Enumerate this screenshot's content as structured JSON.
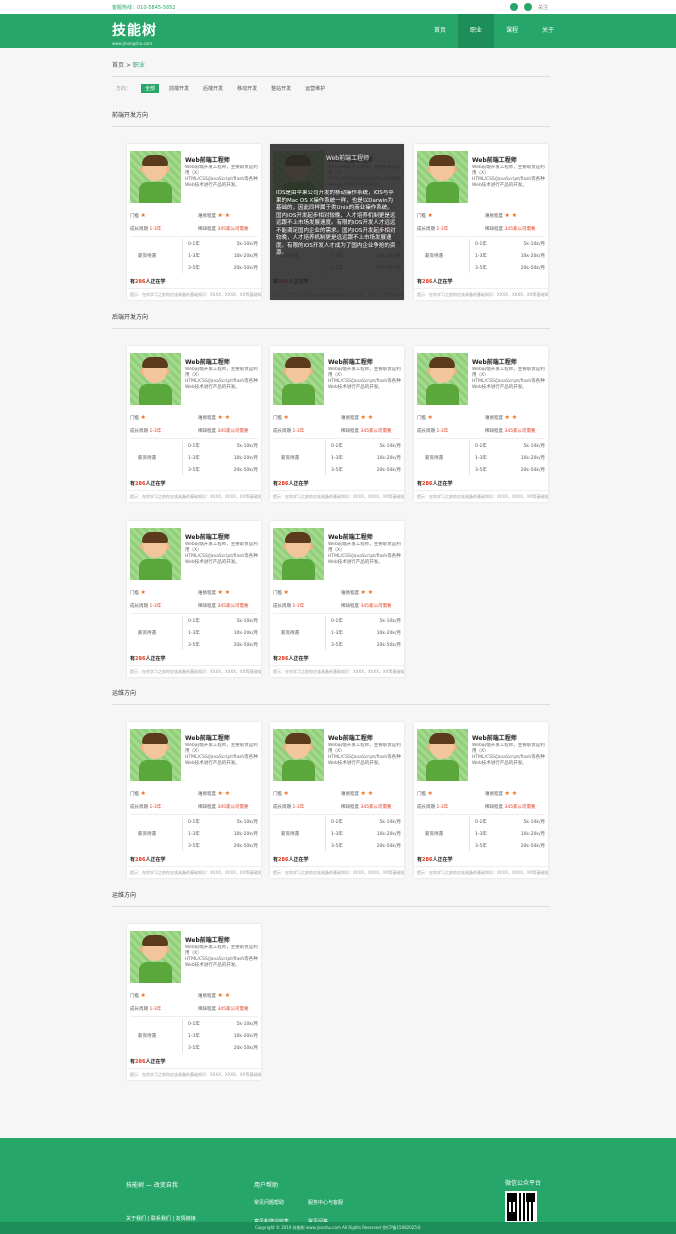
{
  "topbar": {
    "phone": "客服热线：010-5845-5852",
    "icons": [
      "weixin-icon",
      "weibo-icon"
    ],
    "qq": "关注"
  },
  "header": {
    "logo": "技能树",
    "logo_sub": "www.jinengshu.com"
  },
  "nav": [
    "首页",
    "职业",
    "课程",
    "关于"
  ],
  "breadcrumb": {
    "home": "首页",
    "sep": " > ",
    "current": "职业"
  },
  "filters": {
    "label": "方向：",
    "items": [
      "全部",
      "前端开发",
      "后端开发",
      "移动开发",
      "整站开发",
      "运营维护"
    ],
    "active": 0
  },
  "sections": [
    "前端开发方向",
    "后端开发方向",
    "运维方向",
    "运维方向"
  ],
  "card": {
    "title": "Web前端工程师",
    "desc": "Web前端开发工程师，主要职责是利用（X）HTML/CSS/JavaScript/flash等各种Web技术进行产品的开发。",
    "threshold_label": "门槛",
    "difficulty_label": "难易程度",
    "growth_label": "成长周期",
    "growth_value": "1-3年",
    "demand_label": "稀缺程度",
    "demand_value": "345家公司需要",
    "salary_label": "薪资待遇",
    "salary_rows": [
      {
        "years": "0-1年",
        "pay": "5k-10k/月"
      },
      {
        "years": "1-3年",
        "pay": "10k-20k/月"
      },
      {
        "years": "3-5年",
        "pay": "20k-50k/月"
      }
    ],
    "learn_prefix": "有",
    "learn_count": "286",
    "learn_suffix": "人正在学",
    "foot": "提示：在你学习之前你应该具备的基础知识：XXXX，XXXX，XX等基础知识"
  },
  "overlay": {
    "title": "Web前端工程师",
    "text": "IOS是由苹果公司开发的移动操作系统，iOS与苹果的Mac OS X操作系统一样，也是以Darwin为基础的，因此同样属于类Unix的商业操作系统。国内iOS开发起步相对较晚，人才培养机制更是远远跟不上市场发展速度。有限的iOS开发人才远远不能满足国内企业的需求。国内iOS开发起步相对较晚，人才培养机制更是远远跟不上市场发展速度。有限的iOS开发人才成为了国内企业争抢的资源。"
  },
  "footer": {
    "col1_title": "技能树 — 改变自我",
    "col1_links": "关于我们 | 联系我们 | 友情链接",
    "col2_title": "用户帮助",
    "col2_links": [
      "常见问题帮助",
      "服务中心与客服",
      "意见和建议收集",
      "常见问答"
    ],
    "col3_title": "微信公众平台",
    "copyright": "Copyright © 2016 技能树 www.jineshu.com All Rights Reserved  京ICP备15082025号"
  },
  "colors": {
    "brand": "#27a66a",
    "accent_red": "#e03a1a",
    "star": "#f06c1a"
  }
}
